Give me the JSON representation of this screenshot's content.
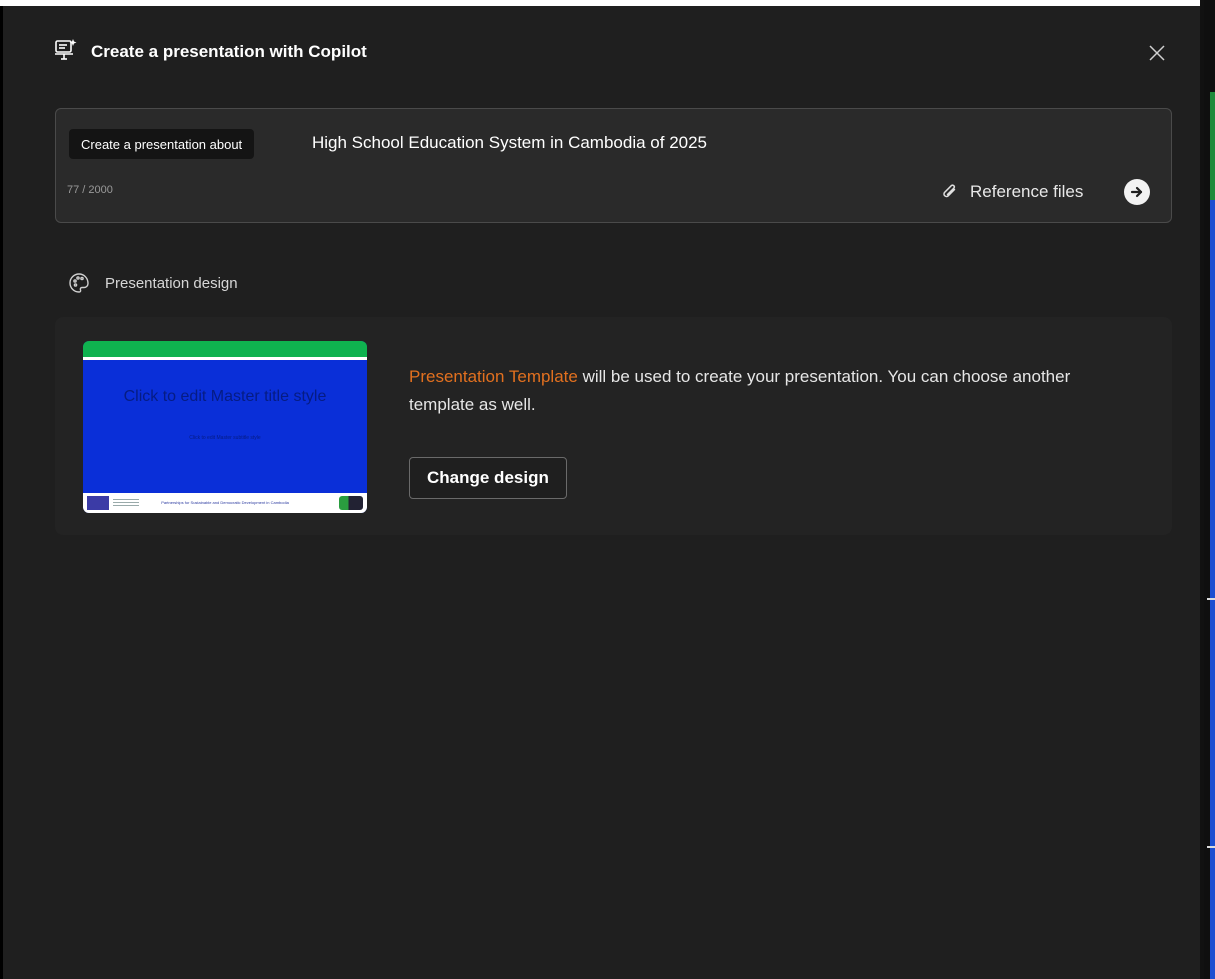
{
  "dialog": {
    "title": "Create a presentation with Copilot"
  },
  "prompt": {
    "chip_label": "Create a presentation about",
    "text": "High School Education System in Cambodia of 2025",
    "char_count": "77 / 2000",
    "reference_files_label": "Reference files"
  },
  "design": {
    "section_label": "Presentation design",
    "template_name": "Presentation Template",
    "description_rest": " will be used to create your presentation. You can choose another template as well.",
    "change_button_label": "Change design",
    "thumbnail": {
      "title": "Click to edit Master title style",
      "subtitle": "Click to edit Master subtitle style",
      "footer": "Partnerships for Sustainable and Democratic Development in Cambodia"
    }
  },
  "icons": {
    "header": "presentation-copilot-icon",
    "close": "close-icon",
    "attach": "paperclip-icon",
    "send": "arrow-right-circle-icon",
    "palette": "palette-icon"
  },
  "colors": {
    "background": "#1f1f1f",
    "accent_template": "#e2701f",
    "thumbnail_blue": "#0a2fd8",
    "thumbnail_green": "#0fb24f"
  }
}
